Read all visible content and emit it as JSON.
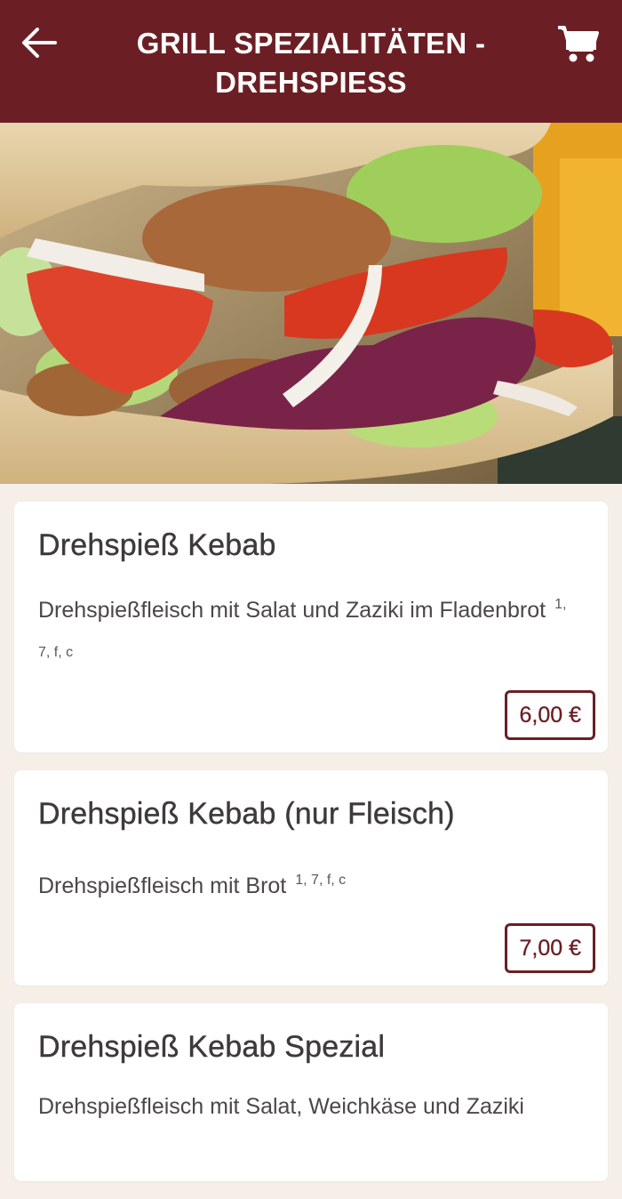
{
  "header": {
    "title": "GRILL SPEZIALITÄTEN - DREHSPIESS",
    "back_icon": "arrow-left-icon",
    "cart_icon": "shopping-cart-icon",
    "background": "#6b1f24"
  },
  "hero_image": {
    "description": "kebab sandwich photo"
  },
  "items": [
    {
      "name": "Drehspieß Kebab",
      "description": "Drehspießfleisch mit Salat und Zaziki im Fladenbrot",
      "allergens": "1, 7, f, c",
      "price": "6,00 €"
    },
    {
      "name": "Drehspieß Kebab (nur Fleisch)",
      "description": "Drehspießfleisch mit Brot",
      "allergens": "1, 7, f, c",
      "price": "7,00 €"
    },
    {
      "name": "Drehspieß Kebab Spezial",
      "description": "Drehspießfleisch mit Salat, Weichkäse und Zaziki"
    }
  ]
}
